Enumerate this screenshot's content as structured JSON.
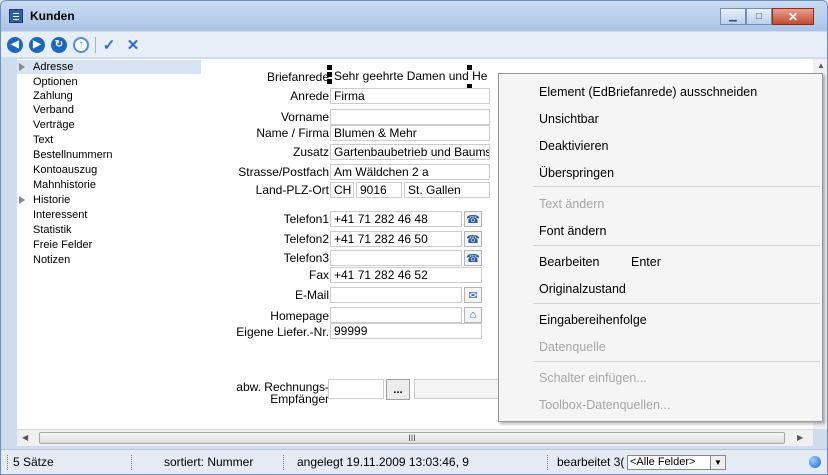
{
  "window": {
    "title": "Kunden"
  },
  "toolbar": {
    "buttons": [
      "back",
      "forward",
      "refresh",
      "up",
      "confirm",
      "cancel"
    ]
  },
  "nav": {
    "items": [
      {
        "label": "Adresse",
        "expandable": true
      },
      {
        "label": "Optionen"
      },
      {
        "label": "Zahlung"
      },
      {
        "label": "Verband"
      },
      {
        "label": "Verträge"
      },
      {
        "label": "Text"
      },
      {
        "label": "Bestellnummern"
      },
      {
        "label": "Kontoauszug"
      },
      {
        "label": "Mahnhistorie"
      },
      {
        "label": "Historie",
        "expandable": true
      },
      {
        "label": "Interessent"
      },
      {
        "label": "Statistik"
      },
      {
        "label": "Freie Felder"
      },
      {
        "label": "Notizen"
      }
    ]
  },
  "form": {
    "briefanrede": {
      "label": "Briefanrede",
      "value": "Sehr geehrte Damen und He"
    },
    "anrede": {
      "label": "Anrede",
      "value": "Firma"
    },
    "vorname": {
      "label": "Vorname",
      "value": ""
    },
    "name": {
      "label": "Name / Firma",
      "value": "Blumen & Mehr"
    },
    "zusatz": {
      "label": "Zusatz",
      "value": "Gartenbaubetrieb und Baums"
    },
    "strasse": {
      "label": "Strasse/Postfach",
      "value": "Am Wäldchen 2 a"
    },
    "ort": {
      "label": "Land-PLZ-Ort",
      "land": "CH",
      "plz": "9016",
      "ort": "St. Gallen"
    },
    "telefon1": {
      "label": "Telefon1",
      "value": "+41 71 282 46 48"
    },
    "telefon2": {
      "label": "Telefon2",
      "value": "+41 71 282 46 50"
    },
    "telefon3": {
      "label": "Telefon3",
      "value": ""
    },
    "fax": {
      "label": "Fax",
      "value": "+41 71 282 46 52"
    },
    "email": {
      "label": "E-Mail",
      "value": ""
    },
    "homepage": {
      "label": "Homepage",
      "value": ""
    },
    "lieferantennr": {
      "label": "Eigene Liefer.-Nr.",
      "value": "99999"
    },
    "rechnung": {
      "label_line1": "abw. Rechnungs-",
      "label_line2": "Empfänger",
      "button": "..."
    }
  },
  "context_menu": {
    "items": [
      {
        "label": "Element (EdBriefanrede) ausschneiden",
        "shortcut": "",
        "enabled": true
      },
      {
        "label": "Unsichtbar",
        "shortcut": "",
        "enabled": true
      },
      {
        "label": "Deaktivieren",
        "shortcut": "",
        "enabled": true
      },
      {
        "label": "Überspringen",
        "shortcut": "",
        "enabled": true
      },
      {
        "label": "Text ändern",
        "shortcut": "",
        "enabled": false
      },
      {
        "label": "Font ändern",
        "shortcut": "",
        "enabled": true
      },
      {
        "label": "Bearbeiten",
        "shortcut": "Enter",
        "enabled": true
      },
      {
        "label": "Originalzustand",
        "shortcut": "",
        "enabled": true
      },
      {
        "label": "Eingabereihenfolge",
        "shortcut": "",
        "enabled": true
      },
      {
        "label": "Datenquelle",
        "shortcut": "",
        "enabled": false
      },
      {
        "label": "Schalter einfügen...",
        "shortcut": "",
        "enabled": false
      },
      {
        "label": "Toolbox-Datenquellen...",
        "shortcut": "",
        "enabled": false
      }
    ]
  },
  "scrollbar": {
    "thumb_grip": "III"
  },
  "statusbar": {
    "records": "5 Sätze",
    "sort": "sortiert: Nummer",
    "created": "angelegt 19.11.2009 13:03:46,  9",
    "edited": "bearbeitet 3(",
    "field_filter": "<Alle Felder>"
  },
  "colors": {
    "accent": "#1e66c4",
    "menu_disabled": "#a6a6a6",
    "close_button": "#c54b2e"
  }
}
